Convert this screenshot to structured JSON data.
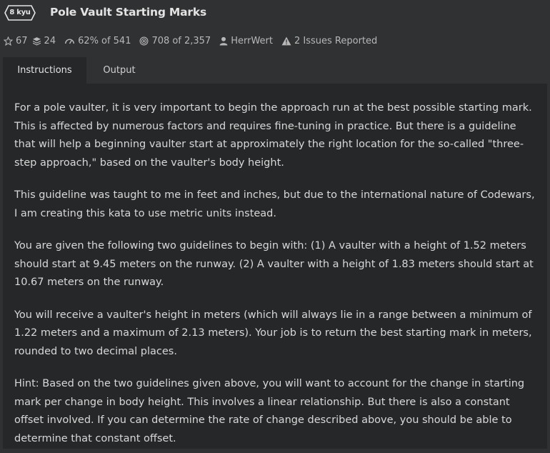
{
  "kata": {
    "rank": "8 kyu",
    "title": "Pole Vault Starting Marks"
  },
  "stats": {
    "stars": "67",
    "collections": "24",
    "satisfaction": "62%",
    "satisfaction_of": "of 541",
    "completed": "708",
    "completed_of": "of 2,357",
    "author": "HerrWert",
    "issues": "2 Issues Reported"
  },
  "tabs": [
    {
      "label": "Instructions",
      "active": true
    },
    {
      "label": "Output",
      "active": false
    }
  ],
  "description": [
    "For a pole vaulter, it is very important to begin the approach run at the best possible starting mark. This is affected by numerous factors and requires fine-tuning in practice. But there is a guideline that will help a beginning vaulter start at approximately the right location for the so-called \"three-step approach,\" based on the vaulter's body height.",
    "This guideline was taught to me in feet and inches, but due to the international nature of Codewars, I am creating this kata to use metric units instead.",
    "You are given the following two guidelines to begin with: (1) A vaulter with a height of 1.52 meters should start at 9.45 meters on the runway. (2) A vaulter with a height of 1.83 meters should start at 10.67 meters on the runway.",
    "You will receive a vaulter's height in meters (which will always lie in a range between a minimum of 1.22 meters and a maximum of 2.13 meters). Your job is to return the best starting mark in meters, rounded to two decimal places.",
    "Hint: Based on the two guidelines given above, you will want to account for the change in starting mark per change in body height. This involves a linear relationship. But there is also a constant offset involved. If you can determine the rate of change described above, you should be able to determine that constant offset."
  ],
  "icons": {
    "star": "star-icon",
    "collection": "stack-icon",
    "satisfaction": "gauge-icon",
    "completed": "target-icon",
    "author": "user-icon",
    "issues": "warning-icon"
  },
  "colors": {
    "background": "#303133",
    "panel": "#262729",
    "text": "#d8d8d8"
  }
}
